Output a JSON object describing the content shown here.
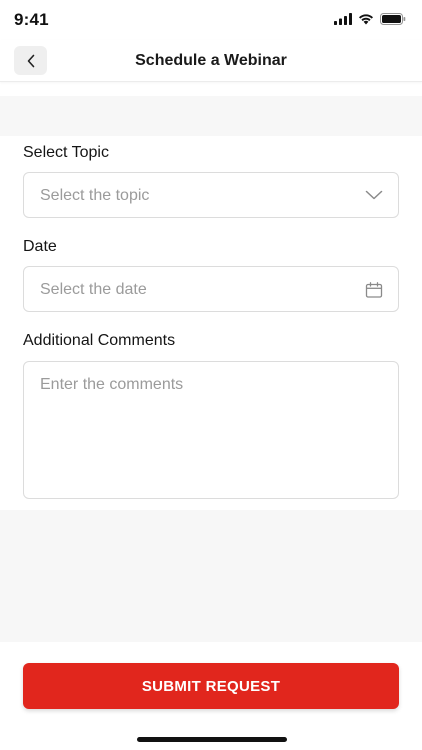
{
  "status_bar": {
    "time": "9:41",
    "icons": [
      "signal-icon",
      "wifi-icon",
      "battery-icon"
    ]
  },
  "header": {
    "title": "Schedule a Webinar",
    "back_icon": "chevron-left-icon"
  },
  "form": {
    "topic": {
      "label": "Select Topic",
      "placeholder": "Select the topic",
      "icon": "chevron-down-icon"
    },
    "date": {
      "label": "Date",
      "placeholder": "Select the date",
      "icon": "calendar-icon"
    },
    "comments": {
      "label": "Additional Comments",
      "placeholder": "Enter the comments"
    }
  },
  "submit": {
    "label": "SUBMIT REQUEST"
  },
  "colors": {
    "accent": "#e1261d",
    "placeholder": "#9b9b9b",
    "border": "#dcdcdc",
    "band": "#f7f7f7"
  }
}
